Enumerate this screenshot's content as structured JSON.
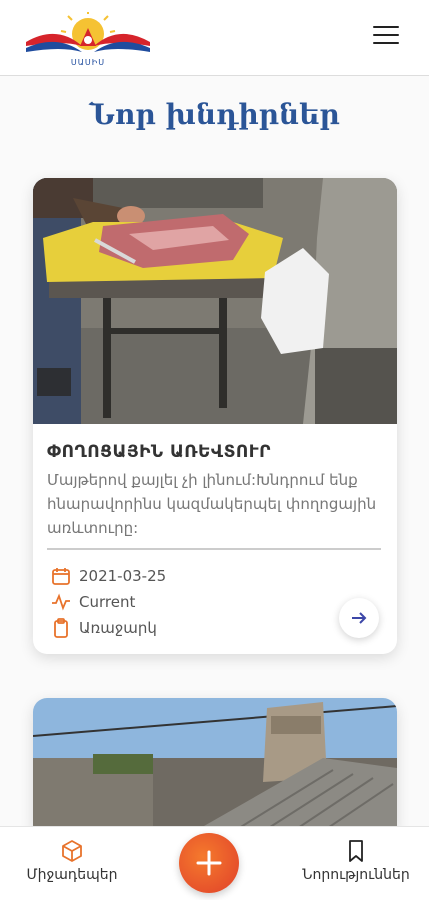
{
  "header": {
    "logo_text": "ՍԱՍԻՍ"
  },
  "page_title": "Նոր խնդիրներ",
  "cards": [
    {
      "title": "ՓՈՂՈՑԱՅԻՆ ԱՌԵՎՏՈՒՐ",
      "description": "Մայթերով քայլել չի լինում:Խնդրում ենք հնարավորինս կազմակերպել փողոցային առևտուրը:",
      "date": "2021-03-25",
      "status": "Current",
      "type": "Առաջարկ"
    },
    {}
  ],
  "bottom_nav": {
    "left_label": "Միջադեպեր",
    "right_label": "Նորություններ"
  },
  "colors": {
    "accent": "#e8732c",
    "title_blue": "#2b5597"
  }
}
